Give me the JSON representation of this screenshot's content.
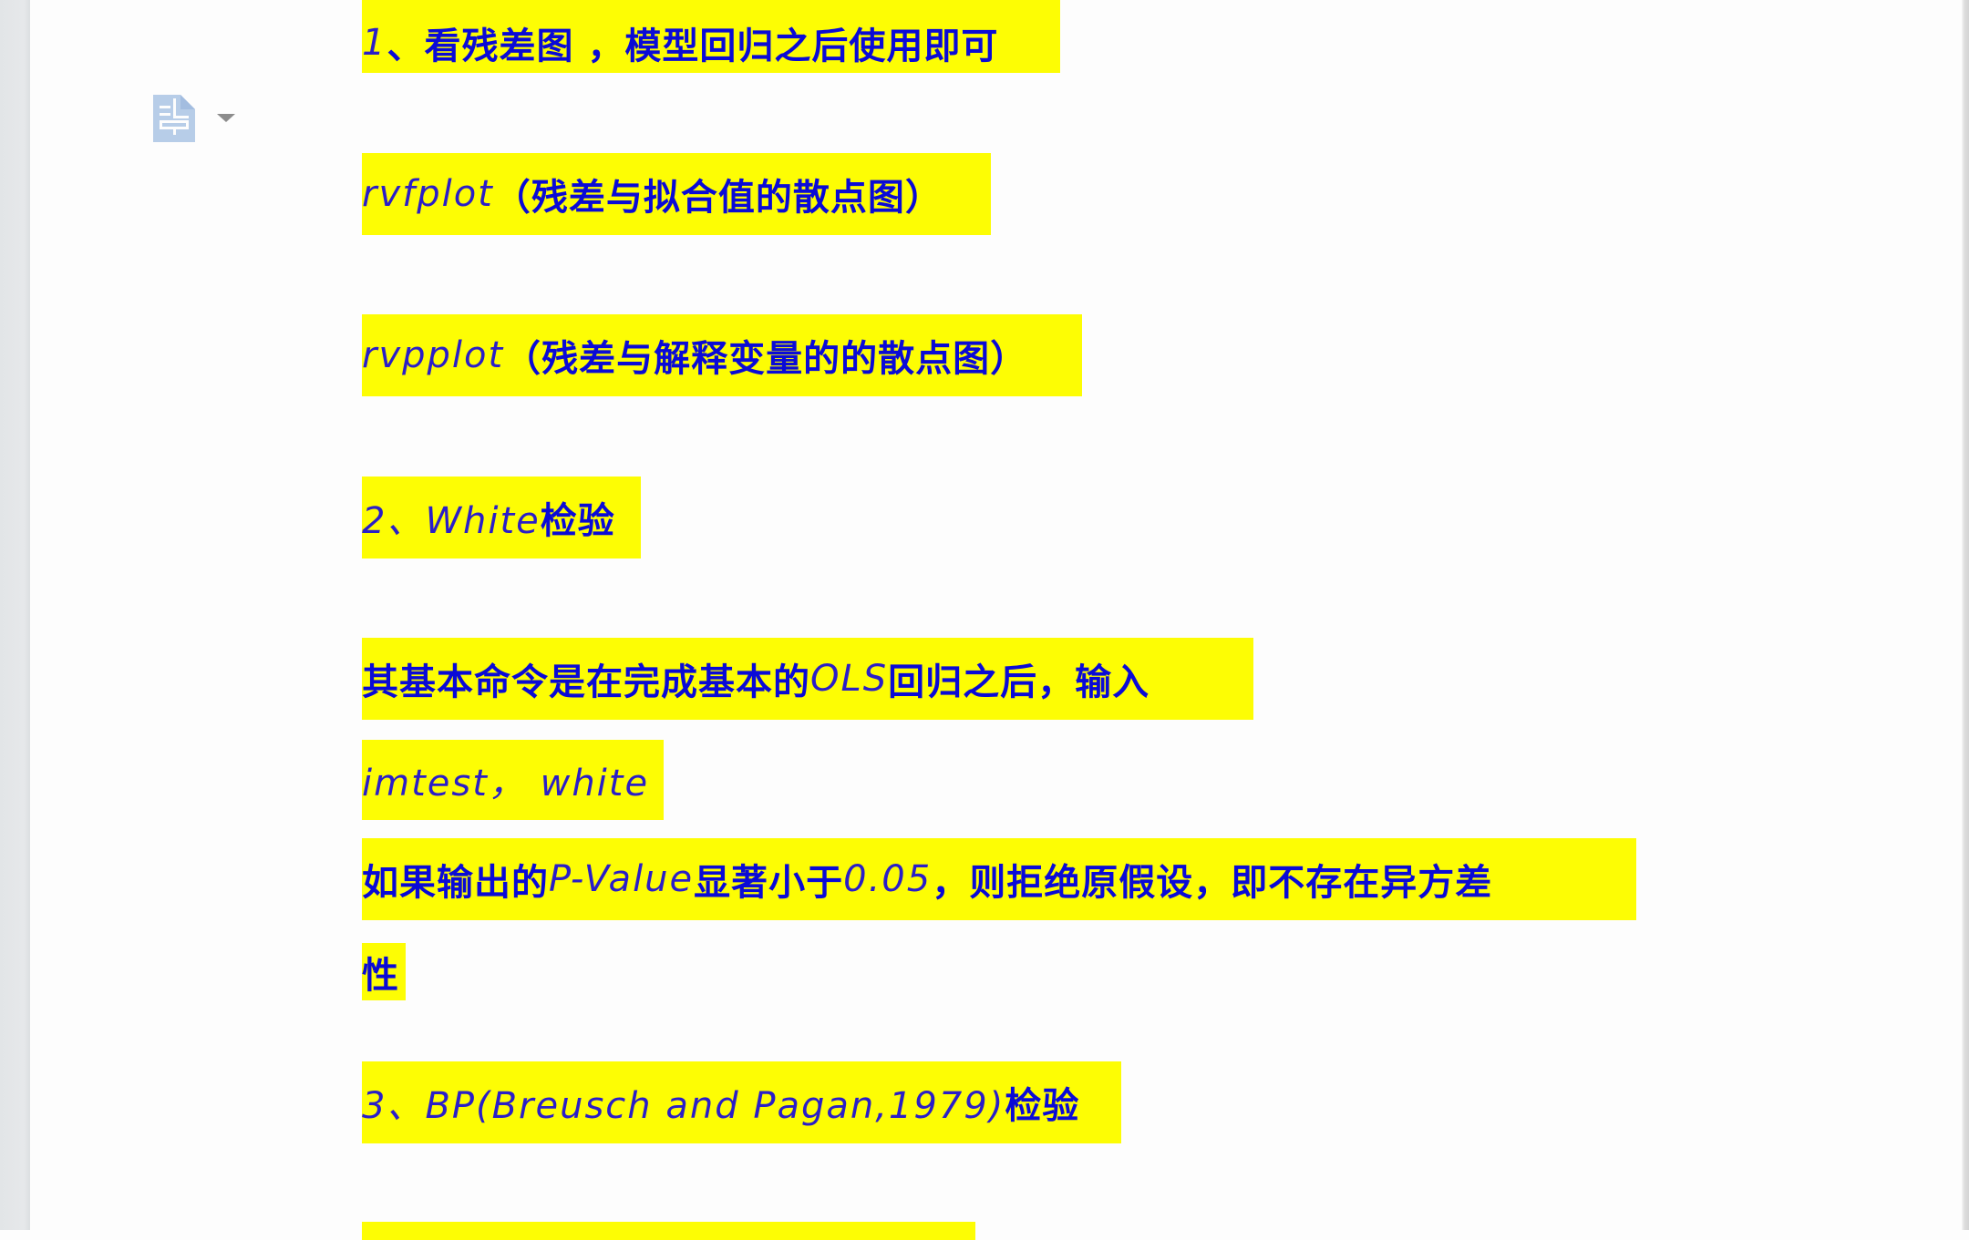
{
  "document": {
    "toolbar": {
      "doc_icon": "document-icon",
      "dropdown_icon": "caret-down-icon"
    },
    "highlight_color": "#fdfd04",
    "text_color": "#0a0ad6",
    "lines": [
      {
        "id": "l1",
        "segments": [
          {
            "text": "1",
            "style": "latin"
          },
          {
            "text": "、看残差图 ，模型回归之后使用即可",
            "style": "cjk"
          }
        ]
      },
      {
        "id": "l2",
        "segments": [
          {
            "text": "rvfplot",
            "style": "latin"
          },
          {
            "text": "（残差与拟合值的散点图）",
            "style": "cjk"
          }
        ]
      },
      {
        "id": "l3",
        "segments": [
          {
            "text": "rvpplot",
            "style": "latin"
          },
          {
            "text": "（残差与解释变量的的散点图）",
            "style": "cjk"
          }
        ]
      },
      {
        "id": "l4",
        "segments": [
          {
            "text": "2、White ",
            "style": "latin"
          },
          {
            "text": "检验",
            "style": "cjk"
          }
        ]
      },
      {
        "id": "l5",
        "segments": [
          {
            "text": "其基本命令是在完成基本的 ",
            "style": "cjk"
          },
          {
            "text": "OLS",
            "style": "latin"
          },
          {
            "text": " 回归之后，输入",
            "style": "cjk"
          }
        ]
      },
      {
        "id": "l6",
        "segments": [
          {
            "text": "imtest， white",
            "style": "latin"
          }
        ]
      },
      {
        "id": "l7",
        "segments": [
          {
            "text": "如果输出的 ",
            "style": "cjk"
          },
          {
            "text": "P-Value",
            "style": "latin"
          },
          {
            "text": " 显著小于 ",
            "style": "cjk"
          },
          {
            "text": "0.05",
            "style": "latin"
          },
          {
            "text": "，则拒绝原假设，即不存在异方差",
            "style": "cjk"
          }
        ]
      },
      {
        "id": "l8",
        "segments": [
          {
            "text": "性",
            "style": "cjk"
          }
        ]
      },
      {
        "id": "l9",
        "segments": [
          {
            "text": "3、BP(Breusch and Pagan,1979)",
            "style": "latin"
          },
          {
            "text": "检验",
            "style": "cjk"
          }
        ]
      },
      {
        "id": "l10",
        "segments": []
      }
    ]
  }
}
